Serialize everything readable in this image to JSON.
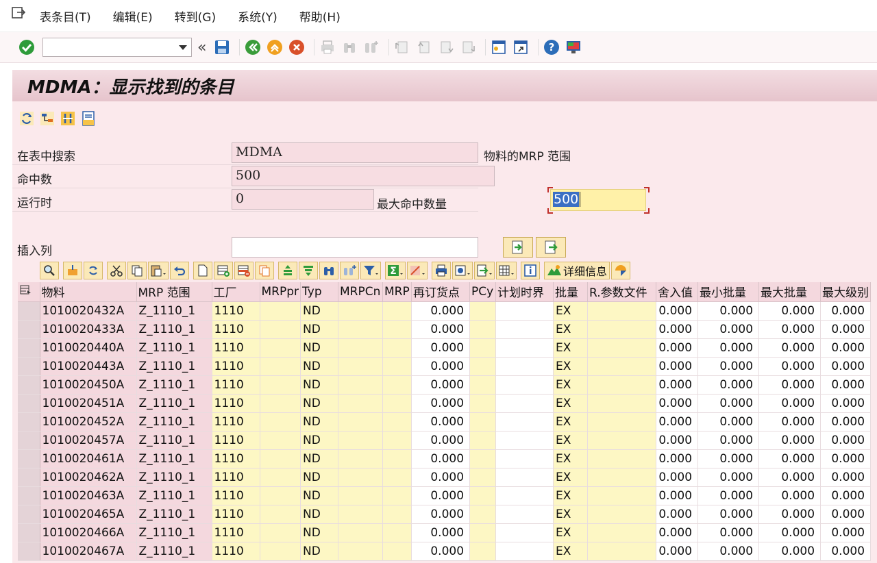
{
  "menu": {
    "items": [
      "表条目(T)",
      "编辑(E)",
      "转到(G)",
      "系统(Y)",
      "帮助(H)"
    ]
  },
  "toolbar": {
    "command_field_value": ""
  },
  "title": "MDMA：显示找到的条目",
  "form": {
    "search_label": "在表中搜索",
    "search_value": "MDMA",
    "search_desc": "物料的MRP 范围",
    "hits_label": "命中数",
    "hits_value": "500",
    "runtime_label": "运行时",
    "runtime_value": "0",
    "max_hits_label": "最大命中数量",
    "max_hits_value": "500",
    "insert_col_label": "插入列"
  },
  "alv": {
    "detail_label": "详细信息"
  },
  "table": {
    "columns": [
      "物料",
      "MRP 范围",
      "工厂",
      "MRPpr",
      "Typ",
      "MRPCn",
      "MRP",
      "再订货点",
      "PCy",
      "计划时界",
      "批量",
      "R.参数文件",
      "舍入值",
      "最小批量",
      "最大批量",
      "最大级别"
    ],
    "rows": [
      {
        "material": "1010020432A",
        "mrp_area": "Z_1110_1",
        "plant": "1110",
        "typ": "ND",
        "reorder": "0.000",
        "lot": "EX",
        "rounding": "0.000",
        "min_lot": "0.000",
        "max_lot": "0.000",
        "max_level": "0.000"
      },
      {
        "material": "1010020433A",
        "mrp_area": "Z_1110_1",
        "plant": "1110",
        "typ": "ND",
        "reorder": "0.000",
        "lot": "EX",
        "rounding": "0.000",
        "min_lot": "0.000",
        "max_lot": "0.000",
        "max_level": "0.000"
      },
      {
        "material": "1010020440A",
        "mrp_area": "Z_1110_1",
        "plant": "1110",
        "typ": "ND",
        "reorder": "0.000",
        "lot": "EX",
        "rounding": "0.000",
        "min_lot": "0.000",
        "max_lot": "0.000",
        "max_level": "0.000"
      },
      {
        "material": "1010020443A",
        "mrp_area": "Z_1110_1",
        "plant": "1110",
        "typ": "ND",
        "reorder": "0.000",
        "lot": "EX",
        "rounding": "0.000",
        "min_lot": "0.000",
        "max_lot": "0.000",
        "max_level": "0.000"
      },
      {
        "material": "1010020450A",
        "mrp_area": "Z_1110_1",
        "plant": "1110",
        "typ": "ND",
        "reorder": "0.000",
        "lot": "EX",
        "rounding": "0.000",
        "min_lot": "0.000",
        "max_lot": "0.000",
        "max_level": "0.000"
      },
      {
        "material": "1010020451A",
        "mrp_area": "Z_1110_1",
        "plant": "1110",
        "typ": "ND",
        "reorder": "0.000",
        "lot": "EX",
        "rounding": "0.000",
        "min_lot": "0.000",
        "max_lot": "0.000",
        "max_level": "0.000"
      },
      {
        "material": "1010020452A",
        "mrp_area": "Z_1110_1",
        "plant": "1110",
        "typ": "ND",
        "reorder": "0.000",
        "lot": "EX",
        "rounding": "0.000",
        "min_lot": "0.000",
        "max_lot": "0.000",
        "max_level": "0.000"
      },
      {
        "material": "1010020457A",
        "mrp_area": "Z_1110_1",
        "plant": "1110",
        "typ": "ND",
        "reorder": "0.000",
        "lot": "EX",
        "rounding": "0.000",
        "min_lot": "0.000",
        "max_lot": "0.000",
        "max_level": "0.000"
      },
      {
        "material": "1010020461A",
        "mrp_area": "Z_1110_1",
        "plant": "1110",
        "typ": "ND",
        "reorder": "0.000",
        "lot": "EX",
        "rounding": "0.000",
        "min_lot": "0.000",
        "max_lot": "0.000",
        "max_level": "0.000"
      },
      {
        "material": "1010020462A",
        "mrp_area": "Z_1110_1",
        "plant": "1110",
        "typ": "ND",
        "reorder": "0.000",
        "lot": "EX",
        "rounding": "0.000",
        "min_lot": "0.000",
        "max_lot": "0.000",
        "max_level": "0.000"
      },
      {
        "material": "1010020463A",
        "mrp_area": "Z_1110_1",
        "plant": "1110",
        "typ": "ND",
        "reorder": "0.000",
        "lot": "EX",
        "rounding": "0.000",
        "min_lot": "0.000",
        "max_lot": "0.000",
        "max_level": "0.000"
      },
      {
        "material": "1010020465A",
        "mrp_area": "Z_1110_1",
        "plant": "1110",
        "typ": "ND",
        "reorder": "0.000",
        "lot": "EX",
        "rounding": "0.000",
        "min_lot": "0.000",
        "max_lot": "0.000",
        "max_level": "0.000"
      },
      {
        "material": "1010020466A",
        "mrp_area": "Z_1110_1",
        "plant": "1110",
        "typ": "ND",
        "reorder": "0.000",
        "lot": "EX",
        "rounding": "0.000",
        "min_lot": "0.000",
        "max_lot": "0.000",
        "max_level": "0.000"
      },
      {
        "material": "1010020467A",
        "mrp_area": "Z_1110_1",
        "plant": "1110",
        "typ": "ND",
        "reorder": "0.000",
        "lot": "EX",
        "rounding": "0.000",
        "min_lot": "0.000",
        "max_lot": "0.000",
        "max_level": "0.000"
      }
    ]
  },
  "colors": {
    "title_band": "#e6c4cc",
    "content_bg": "#fbe9ec",
    "key_cell": "#f4d8de",
    "editable_cell": "#fdf7c4",
    "focus_field": "#fff1a8",
    "selection": "#3b6fc4"
  }
}
